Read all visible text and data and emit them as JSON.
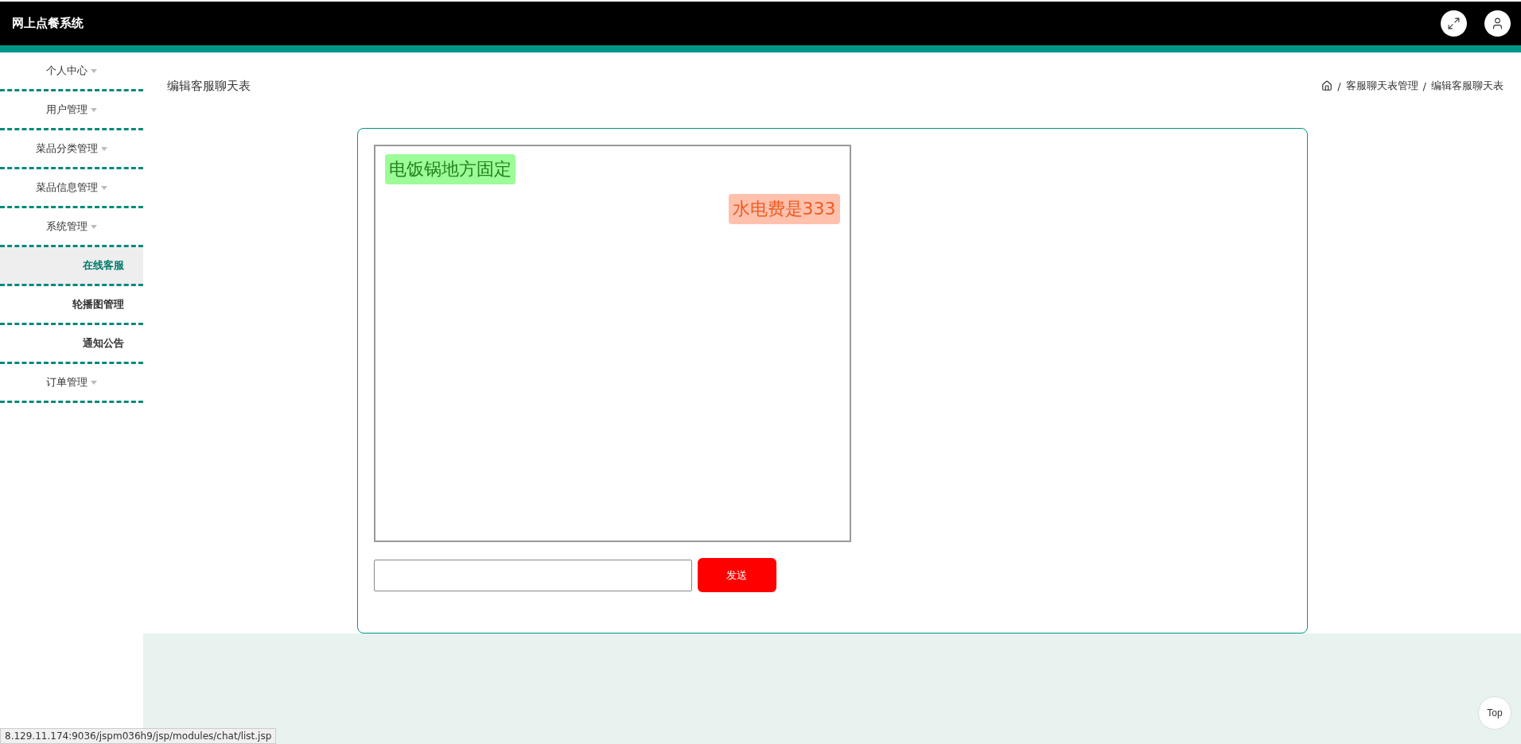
{
  "header": {
    "title": "网上点餐系统"
  },
  "sidebar": {
    "items": [
      {
        "label": "个人中心",
        "kind": "menu",
        "selected": false
      },
      {
        "label": "用户管理",
        "kind": "menu",
        "selected": false
      },
      {
        "label": "菜品分类管理",
        "kind": "menu",
        "selected": false
      },
      {
        "label": "菜品信息管理",
        "kind": "menu",
        "selected": false
      },
      {
        "label": "系统管理",
        "kind": "menu",
        "selected": false
      },
      {
        "label": "在线客服",
        "kind": "sub",
        "selected": true
      },
      {
        "label": "轮播图管理",
        "kind": "sub",
        "selected": false
      },
      {
        "label": "通知公告",
        "kind": "sub",
        "selected": false
      },
      {
        "label": "订单管理",
        "kind": "menu",
        "selected": false
      }
    ]
  },
  "page": {
    "title": "编辑客服聊天表",
    "breadcrumb_separator": "/",
    "breadcrumb": [
      "客服聊天表管理",
      "编辑客服聊天表"
    ]
  },
  "chat": {
    "messages": [
      {
        "text": "电饭锅地方固定",
        "kind": "received"
      },
      {
        "text": "水电费是333",
        "kind": "sent"
      }
    ],
    "send_button": "发送"
  },
  "top_button": "Top",
  "status_url": "8.129.11.174:9036/jspm036h9/jsp/modules/chat/list.jsp"
}
